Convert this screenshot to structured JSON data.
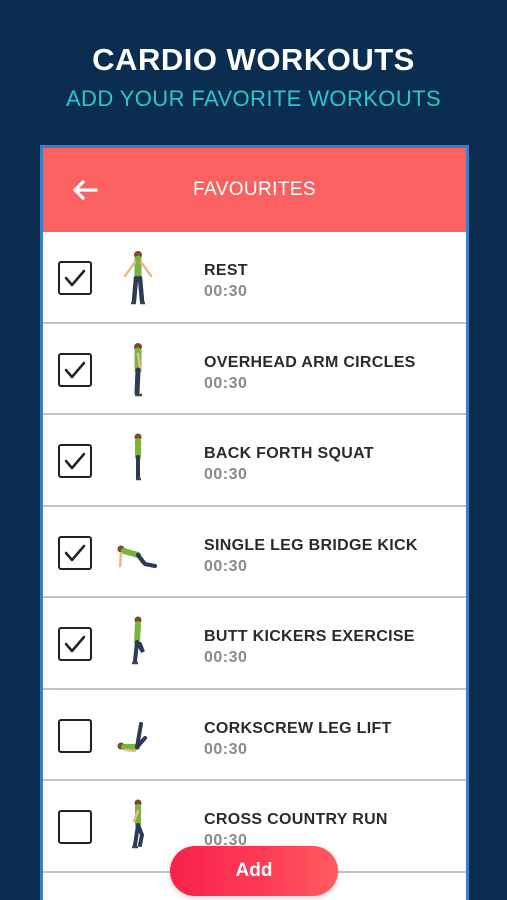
{
  "promo": {
    "title": "CARDIO WORKOUTS",
    "subtitle": "ADD YOUR FAVORITE WORKOUTS"
  },
  "appbar": {
    "title": "FAVOURITES",
    "back_icon": "arrow-left-icon"
  },
  "exercises": [
    {
      "name": "REST",
      "time": "00:30",
      "checked": true,
      "pose": "standing"
    },
    {
      "name": "OVERHEAD ARM CIRCLES",
      "time": "00:30",
      "checked": true,
      "pose": "side-standing"
    },
    {
      "name": "BACK FORTH SQUAT",
      "time": "00:30",
      "checked": true,
      "pose": "side-narrow"
    },
    {
      "name": "SINGLE LEG BRIDGE KICK",
      "time": "00:30",
      "checked": true,
      "pose": "bridge"
    },
    {
      "name": "BUTT KICKERS EXERCISE",
      "time": "00:30",
      "checked": true,
      "pose": "kick"
    },
    {
      "name": "CORKSCREW LEG LIFT",
      "time": "00:30",
      "checked": false,
      "pose": "leg-lift"
    },
    {
      "name": "CROSS COUNTRY RUN",
      "time": "00:30",
      "checked": false,
      "pose": "run"
    }
  ],
  "add_button": {
    "label": "Add"
  },
  "colors": {
    "background": "#0b2d4f",
    "accent_cyan": "#2cc6d3",
    "appbar": "#fb6161",
    "add_button": "#f8214a"
  }
}
